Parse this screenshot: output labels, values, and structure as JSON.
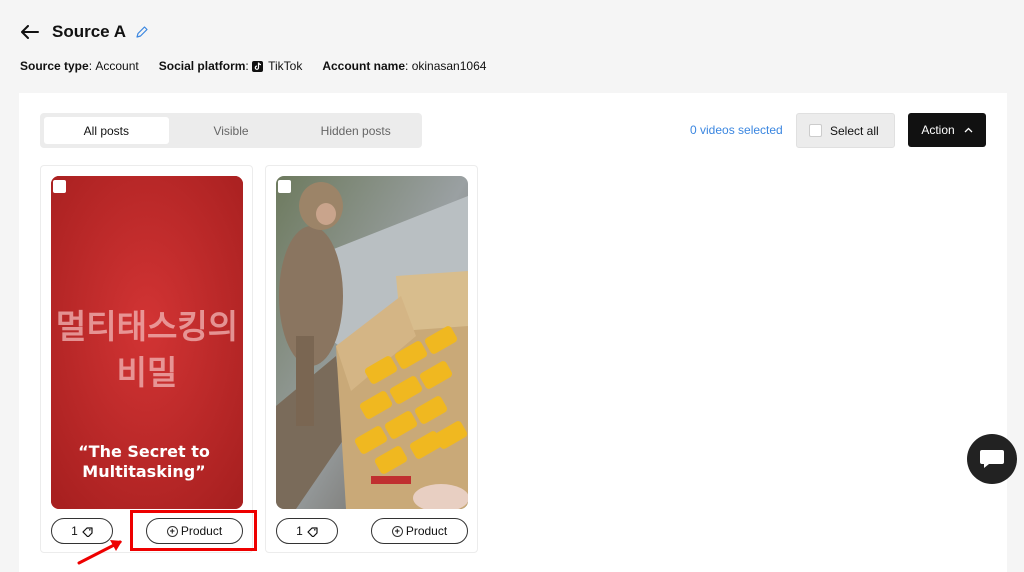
{
  "header": {
    "title": "Source A"
  },
  "meta": {
    "source_type_label": "Source type",
    "source_type_value": "Account",
    "platform_label": "Social platform",
    "platform_value": "TikTok",
    "account_label": "Account name",
    "account_value": "okinasan1064"
  },
  "tabs": [
    {
      "label": "All posts",
      "active": true
    },
    {
      "label": "Visible",
      "active": false
    },
    {
      "label": "Hidden posts",
      "active": false
    }
  ],
  "toolbar": {
    "selected_count": "0 videos selected",
    "select_all_label": "Select all",
    "action_label": "Action"
  },
  "posts": [
    {
      "thumb_text_korean_line1": "멀티태스킹의",
      "thumb_text_korean_line2": "비밀",
      "thumb_caption_line1": "“The Secret to",
      "thumb_caption_line2": "Multitasking”",
      "tag_count": "1",
      "product_label": "Product"
    },
    {
      "tag_count": "1",
      "product_label": "Product"
    }
  ],
  "colors": {
    "accent_link": "#3a86e0",
    "highlight": "#e00000",
    "thumb1_bg": "#c42a2a"
  }
}
